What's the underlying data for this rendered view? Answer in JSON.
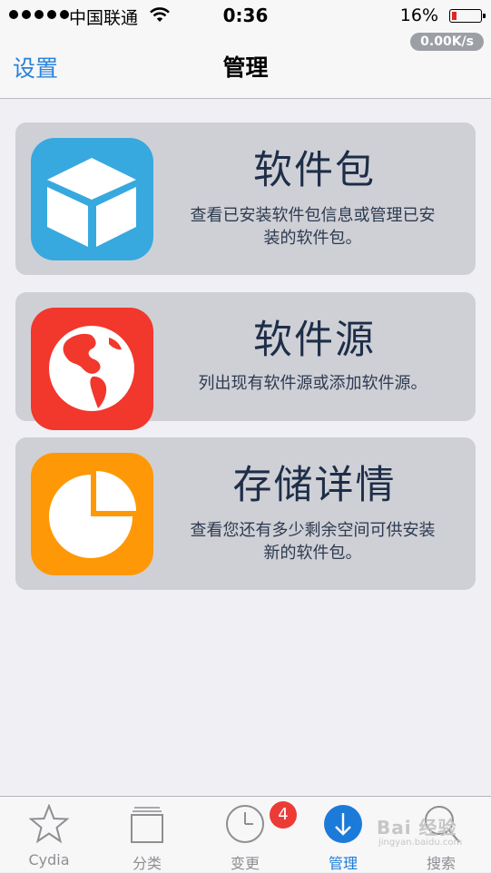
{
  "status_bar": {
    "carrier": "中国联通",
    "time": "0:36",
    "battery_percent": "16%",
    "battery_level": 0.16
  },
  "nav": {
    "back_label": "设置",
    "title": "管理",
    "speed": "0.00K/s"
  },
  "cards": [
    {
      "title": "软件包",
      "desc_line1": "查看已安装软件包信息或管理已安",
      "desc_line2": "装的软件包。",
      "icon": "box-icon",
      "color": "#37a9df"
    },
    {
      "title": "软件源",
      "desc_line1": "列出现有软件源或添加软件源。",
      "icon": "globe-icon",
      "color": "#f2372d"
    },
    {
      "title": "存储详情",
      "desc_line1": "查看您还有多少剩余空间可供安装",
      "desc_line2": "新的软件包。",
      "icon": "pie-chart-icon",
      "color": "#ff9806"
    }
  ],
  "tabs": [
    {
      "label": "Cydia",
      "icon": "star-icon"
    },
    {
      "label": "分类",
      "icon": "sections-icon"
    },
    {
      "label": "变更",
      "icon": "clock-icon",
      "badge": "4"
    },
    {
      "label": "管理",
      "icon": "download-icon",
      "active": true
    },
    {
      "label": "搜索",
      "icon": "search-icon"
    }
  ],
  "watermark": {
    "text": "Bai 经验",
    "sub": "jingyan.baidu.com"
  },
  "colors": {
    "accent": "#2b82d9",
    "card_bg": "#cfd0d6",
    "background": "#efeff4",
    "badge": "#ec3b36"
  }
}
